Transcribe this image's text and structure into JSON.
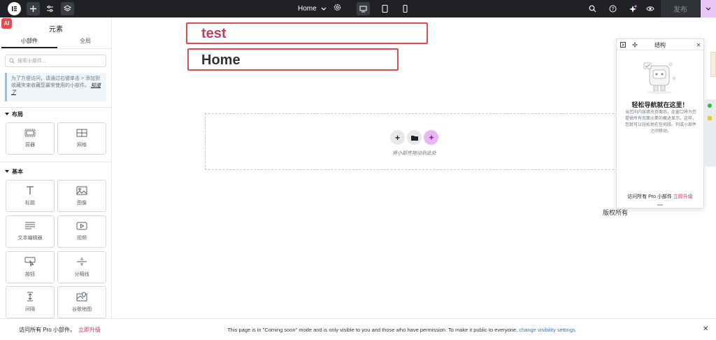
{
  "topbar": {
    "page_name": "Home",
    "publish_label": "发布"
  },
  "sidebar": {
    "badge": "AI",
    "title": "元素",
    "tabs": [
      {
        "label": "小部件",
        "active": true
      },
      {
        "label": "全局",
        "active": false
      }
    ],
    "search_placeholder": "搜索小部件...",
    "tip_text": "为了方便访问，请通过右键单击 > 添加到收藏夹来收藏您最常使用的小部件。",
    "tip_link": "知道了",
    "sections": [
      {
        "title": "布局",
        "widgets": [
          "容器",
          "网格"
        ]
      },
      {
        "title": "基本",
        "widgets": [
          "标题",
          "图像",
          "文本编辑器",
          "视频",
          "按钮",
          "分隔线",
          "间隔",
          "谷歌地图"
        ]
      }
    ],
    "bottom_text": "访问所有 Pro 小部件。",
    "bottom_upgrade": "立即升级"
  },
  "canvas": {
    "heading1": "test",
    "heading2": "Home",
    "dropzone_text": "将小部件拖动到此处",
    "copyright": "版权所有"
  },
  "structure": {
    "title": "结构",
    "heading": "轻松导航就在这里！",
    "description": "当您向内容填充页面后，此窗口将为您提供所有页面元素的概述显示。这样，您就可以轻松地在任何段、列或小部件之间移动。",
    "footer_text": "访问所有 Pro 小部件",
    "footer_upgrade": "立即升级"
  },
  "notice": {
    "text": "This page is in \"Coming soon\" mode and is only visible to you and those who have permission. To make it public to everyone, ",
    "link": "change visibility settings"
  },
  "colors": {
    "accent": "#c23d6b",
    "topbar": "#1f2124",
    "highlight_border": "#e04b4b",
    "ai_purple": "#e8b5f5"
  }
}
